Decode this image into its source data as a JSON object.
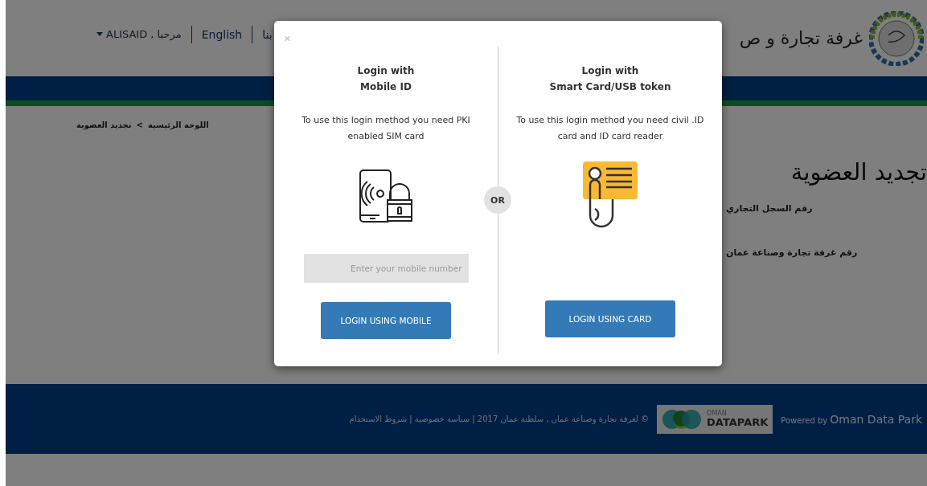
{
  "header": {
    "site_title": "غرفة تجارة و ص",
    "nav": [
      {
        "label": "بنا"
      },
      {
        "label": "English"
      }
    ],
    "user_menu": "ALISAID , مرحبا"
  },
  "breadcrumb": {
    "items": [
      {
        "label": "اللوحة الرئيسية"
      },
      {
        "label": "تجديد العضوية"
      }
    ],
    "separator": ">"
  },
  "page_title": "تجديد العضوية",
  "fields": [
    {
      "label": "رقم السجل التجاري"
    },
    {
      "label": "رقم غرفة تجارة وصناعة عمان"
    }
  ],
  "footer": {
    "copyright": "© لغرفة تجارة وصناعة عمان , سلطنة عمان 2017 | سياسة خصوصية | شروط الاستخدام",
    "partner_logo": {
      "small": "OMAN",
      "large": "DATAPARK"
    },
    "powered_by": "Powered by",
    "powered_name": "Oman Data Park"
  },
  "modal": {
    "close": "×",
    "divider_label": "OR",
    "mobile_login": {
      "title": "Login with",
      "subtitle": "Mobile ID",
      "description": "To use this login method you need PKI enabled SIM card",
      "placeholder": "Enter your mobile number",
      "button": "LOGIN USING MOBILE"
    },
    "card_login": {
      "title": "Login with",
      "subtitle": "Smart Card/USB token",
      "description": "To use this login method you need civil .ID card and ID card reader",
      "button": "LOGIN USING CARD"
    }
  }
}
